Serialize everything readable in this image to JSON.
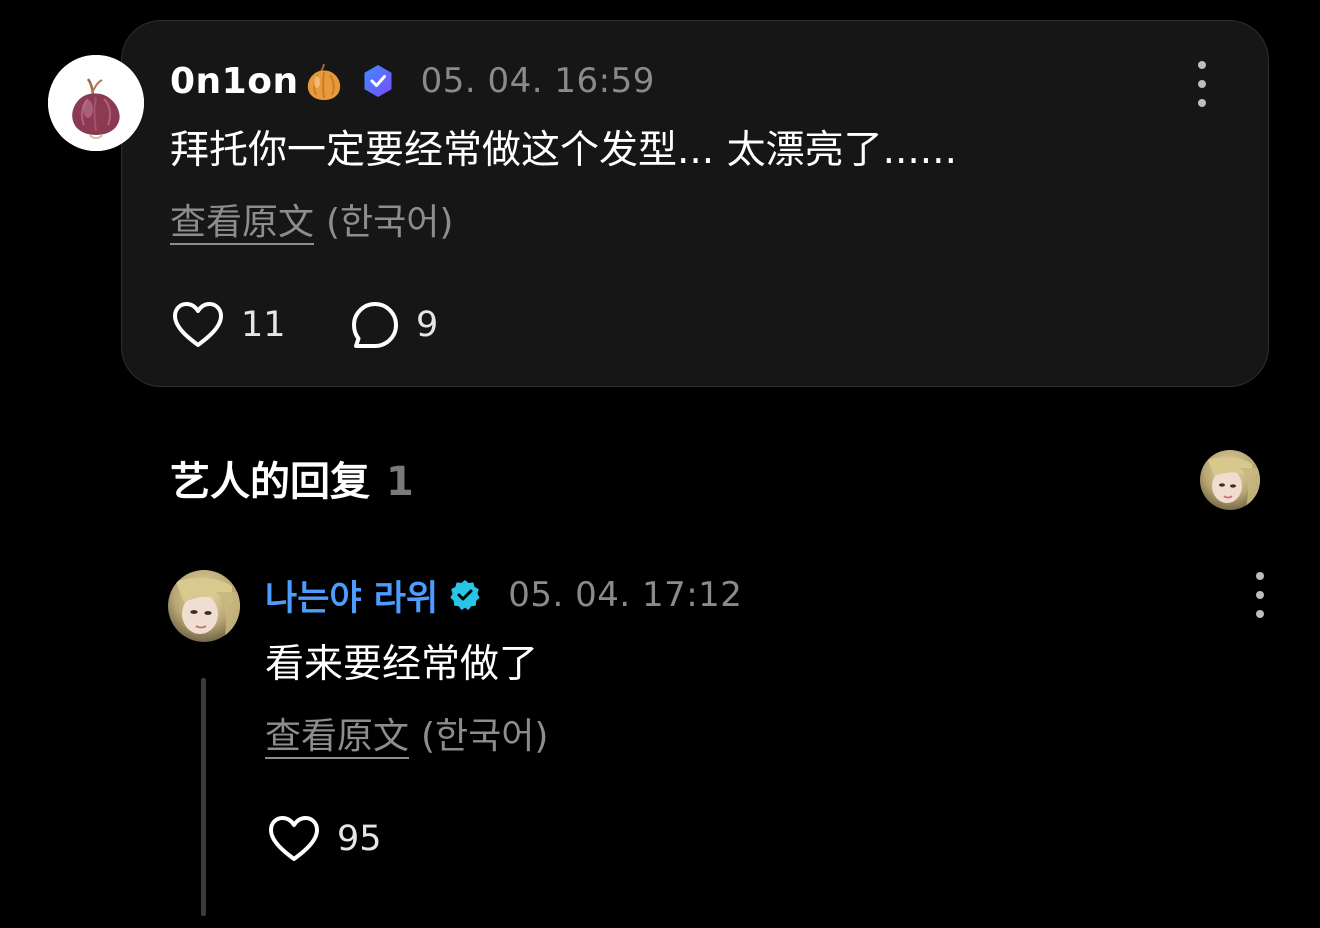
{
  "comment": {
    "username": "0n1on",
    "user_emoji": "onion-emoji",
    "badge": "verified-hexagon-icon",
    "timestamp": "05. 04. 16:59",
    "text": "拜托你一定要经常做这个发型... 太漂亮了......",
    "translate_link": "查看原文",
    "translate_lang": "(한국어)",
    "like_count": "11",
    "reply_count": "9",
    "colors": {
      "card_bg": "#161616",
      "card_border": "#2e2e2e",
      "badge": "#4f6bff"
    }
  },
  "artist_replies": {
    "title": "艺人的回复",
    "count": "1",
    "reply": {
      "username": "나는야 라위",
      "badge": "verified-check-icon",
      "timestamp": "05. 04. 17:12",
      "text": "看来要经常做了",
      "translate_link": "查看原文",
      "translate_lang": "(한국어)",
      "like_count": "95",
      "colors": {
        "username": "#4d9cff",
        "badge": "#29c5e6"
      }
    }
  }
}
